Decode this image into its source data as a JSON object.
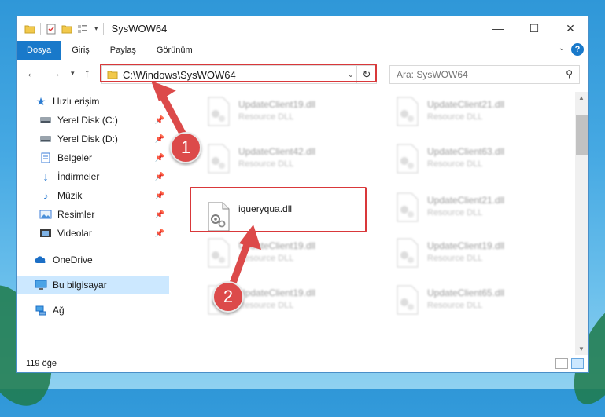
{
  "window": {
    "title": "SysWOW64"
  },
  "ribbon": {
    "tabs": [
      "Dosya",
      "Giriş",
      "Paylaş",
      "Görünüm"
    ],
    "help": "?"
  },
  "address": {
    "path": "C:\\Windows\\SysWOW64"
  },
  "search": {
    "placeholder": "Ara: SysWOW64"
  },
  "sidebar": {
    "items": [
      {
        "label": "Hızlı erişim",
        "icon": "star-icon"
      },
      {
        "label": "Yerel Disk (C:)",
        "icon": "drive-icon"
      },
      {
        "label": "Yerel Disk (D:)",
        "icon": "drive-icon"
      },
      {
        "label": "Belgeler",
        "icon": "documents-icon"
      },
      {
        "label": "İndirmeler",
        "icon": "download-icon"
      },
      {
        "label": "Müzik",
        "icon": "music-icon"
      },
      {
        "label": "Resimler",
        "icon": "pictures-icon"
      },
      {
        "label": "Videolar",
        "icon": "videos-icon"
      },
      {
        "label": "OneDrive",
        "icon": "cloud-icon"
      },
      {
        "label": "Bu bilgisayar",
        "icon": "computer-icon"
      },
      {
        "label": "Ağ",
        "icon": "network-icon"
      }
    ]
  },
  "files": [
    {
      "name": "UpdateClient19.dll",
      "type": "Resource DLL"
    },
    {
      "name": "UpdateClient21.dll",
      "type": "Resource DLL"
    },
    {
      "name": "UpdateClient42.dll",
      "type": "Resource DLL"
    },
    {
      "name": "UpdateClient63.dll",
      "type": "Resource DLL"
    },
    {
      "name": "iqueryqua.dll",
      "type": ""
    },
    {
      "name": "UpdateClient21.dll",
      "type": "Resource DLL"
    },
    {
      "name": "UpdateClient19.dll",
      "type": "Resource DLL"
    },
    {
      "name": "UpdateClient19.dll",
      "type": "Resource DLL"
    },
    {
      "name": "UpdateClient19.dll",
      "type": "Resource DLL"
    },
    {
      "name": "UpdateClient65.dll",
      "type": "Resource DLL"
    }
  ],
  "status": {
    "count": "119 öğe"
  },
  "annotations": {
    "step1": "1",
    "step2": "2",
    "color": "#dc4a4a"
  }
}
